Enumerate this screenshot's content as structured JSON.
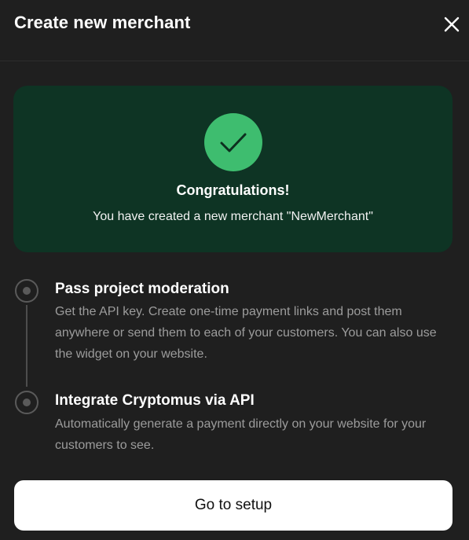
{
  "header": {
    "title": "Create new merchant"
  },
  "success": {
    "heading": "Congratulations!",
    "message": "You have created a new merchant \"NewMerchant\""
  },
  "steps": [
    {
      "title": "Pass project moderation",
      "description": "Get the API key. Create one-time payment links and post them anywhere or send them to each of your customers. You can also use the widget on your website."
    },
    {
      "title": "Integrate Cryptomus via API",
      "description": "Automatically generate a payment directly on your website for your customers to see."
    }
  ],
  "actions": {
    "setup_label": "Go to setup"
  },
  "icons": {
    "close": "close-icon",
    "success": "checkmark-icon",
    "step": "radio-dot-icon"
  },
  "colors": {
    "background": "#1f1f1f",
    "success_card": "#0e3424",
    "success_accent": "#3ebd6f",
    "muted_text": "#9c9c9c",
    "button": "#ffffff"
  }
}
